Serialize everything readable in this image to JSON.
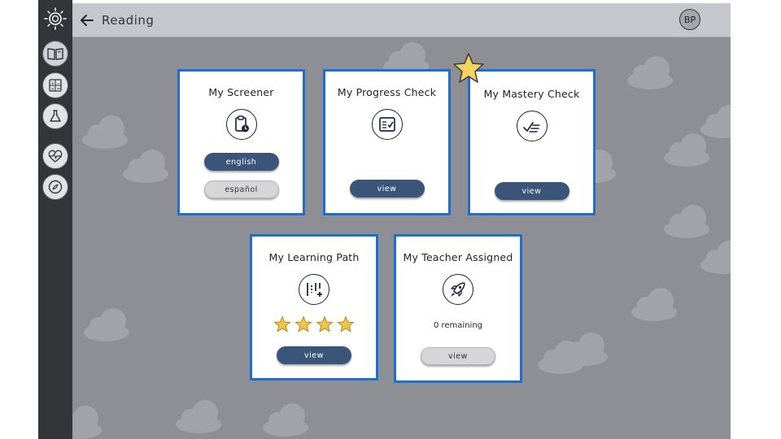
{
  "header": {
    "title": "Reading",
    "avatar_initials": "BP"
  },
  "sidebar": {
    "items": [
      {
        "icon": "book-icon",
        "active": true
      },
      {
        "icon": "calculator-icon"
      },
      {
        "icon": "flask-icon"
      },
      {
        "icon": "heart-pulse-icon"
      },
      {
        "icon": "compass-icon"
      }
    ]
  },
  "cards": {
    "screener": {
      "title": "My Screener",
      "icon": "clipboard-clock-icon",
      "english_label": "english",
      "espanol_label": "español"
    },
    "progress": {
      "title": "My Progress Check",
      "icon": "checklist-icon",
      "view_label": "view"
    },
    "mastery": {
      "title": "My Mastery Check",
      "icon": "check-lines-icon",
      "view_label": "view",
      "badge": "star-icon"
    },
    "learning_path": {
      "title": "My Learning Path",
      "icon": "path-plus-icon",
      "view_label": "view",
      "stars_filled": 4
    },
    "teacher": {
      "title": "My Teacher Assigned",
      "icon": "rocket-icon",
      "remaining": "0 remaining",
      "view_label": "view"
    }
  },
  "colors": {
    "card_border": "#1f6fd1",
    "button_dark": "#3b557a",
    "background": "#8e8f94",
    "star": "#f5c242"
  }
}
